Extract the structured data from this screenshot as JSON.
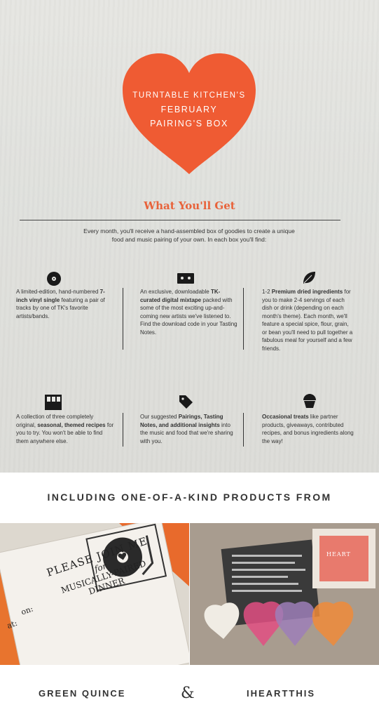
{
  "heart": {
    "line1": "TURNTABLE KITCHEN'S",
    "line2": "FEBRUARY",
    "line3": "PAIRING'S BOX",
    "color": "#ef5b33"
  },
  "section": {
    "heading": "What You'll Get",
    "intro": "Every month, you'll receive a hand-assembled box of goodies to create a unique food and music pairing of your own. In each box you'll find:"
  },
  "items": [
    {
      "icon": "vinyl-record-icon",
      "pre": "A limited-edition, hand-numbered ",
      "bold": "7-inch vinyl single",
      "post": " featuring a pair of tracks by one of TK's favorite artists/bands."
    },
    {
      "icon": "cassette-tape-icon",
      "pre": "An exclusive, downloadable ",
      "bold": "TK-curated digital mixtape",
      "post": " packed with some of the most exciting up-and-coming new artists we've listened to. Find the download code in your Tasting Notes."
    },
    {
      "icon": "leaf-icon",
      "pre": "1-2 ",
      "bold": "Premium dried ingredients",
      "post": " for you to make 2-4 servings of each dish or drink (depending on each month's theme). Each month, we'll feature a special spice, flour, grain, or bean you'll need to pull together a fabulous meal for yourself and a few friends."
    },
    {
      "icon": "recipe-cards-icon",
      "pre": "A collection of three completely original, ",
      "bold": "seasonal, themed recipes",
      "post": " for you to try. You won't be able to find them anywhere else."
    },
    {
      "icon": "tag-icon",
      "pre": "Our suggested ",
      "bold": "Pairings, Tasting Notes, and additional insights",
      "post": " into the music and food that we're sharing with you."
    },
    {
      "icon": "cupcake-icon",
      "pre": "",
      "bold": "Occasional treats",
      "post": " like partner products, giveaways, contributed recipes, and bonus ingredients along the way!"
    }
  ],
  "band": {
    "text": "INCLUDING ONE-OF-A-KIND PRODUCTS FROM"
  },
  "photos": {
    "left": {
      "line1": "PLEASE JOIN ME",
      "line2": "for",
      "line3": "MUSICALLY-PAIRED DINNER",
      "on": "on:",
      "at": "at:"
    },
    "right": {
      "box_label": "HEART"
    }
  },
  "brands": {
    "left": "GREEN QUINCE",
    "amp": "&",
    "right": "IHEARTTHIS"
  }
}
